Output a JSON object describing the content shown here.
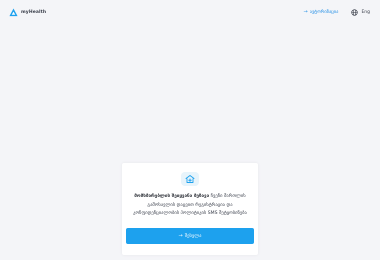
{
  "header": {
    "brand_name": "myHealth",
    "login_label": "ავტორიზაცია",
    "language_label": "Eng"
  },
  "card": {
    "text_bold": "მომხმარებლის შეიყვანა მეზავა",
    "text_rest": " ჩვენი მართლის გამოსავლის დაცვით რეგისტრაცია და კონფიდენციალობის პოლიტიკის SMS შეტყობინება",
    "button_label": "შესვლა"
  },
  "colors": {
    "accent": "#1da1ee",
    "link": "#1f8de6",
    "background": "#f4f5f8",
    "card": "#ffffff",
    "icon_bg": "#e7f4fb"
  },
  "icons": {
    "brand": "triangle-logo-icon",
    "login": "arrow-right-icon",
    "language": "globe-icon",
    "card": "shield-medical-icon",
    "button": "arrow-right-icon"
  }
}
